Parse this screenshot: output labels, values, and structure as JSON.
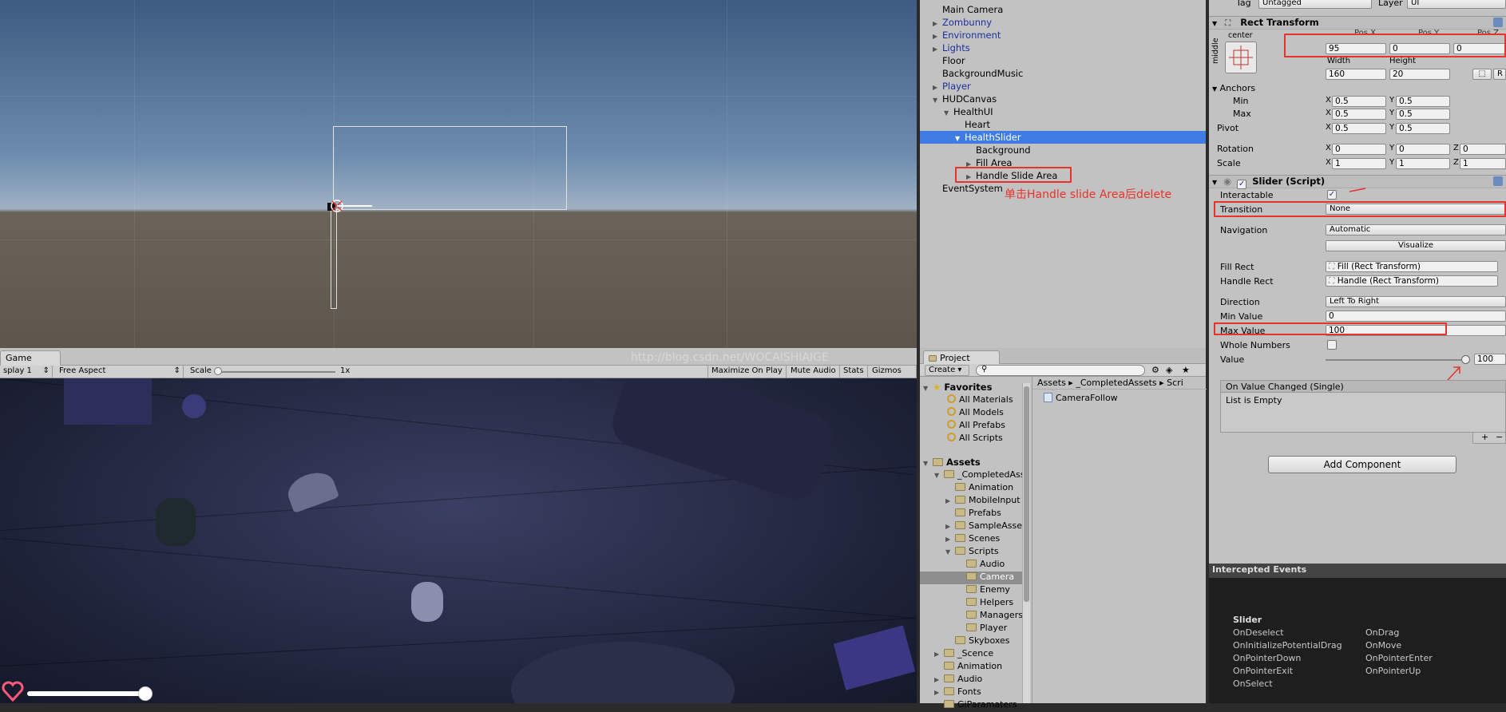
{
  "scene_view": {
    "note": ""
  },
  "game_view": {
    "tab_label": "Game",
    "display": "splay 1",
    "aspect": "Free Aspect",
    "scale_label": "Scale",
    "scale_value": "1x",
    "maximize": "Maximize On Play",
    "mute": "Mute Audio",
    "stats": "Stats",
    "gizmos": "Gizmos",
    "watermark": "http://blog.csdn.net/WOCAISHIAIGE"
  },
  "hierarchy": {
    "items": [
      {
        "label": "Main Camera",
        "depth": 0,
        "arrow": "",
        "style": ""
      },
      {
        "label": "Zombunny",
        "depth": 0,
        "arrow": "▶",
        "style": "blue"
      },
      {
        "label": "Environment",
        "depth": 0,
        "arrow": "▶",
        "style": "blue"
      },
      {
        "label": "Lights",
        "depth": 0,
        "arrow": "▶",
        "style": "blue"
      },
      {
        "label": "Floor",
        "depth": 0,
        "arrow": "",
        "style": ""
      },
      {
        "label": "BackgroundMusic",
        "depth": 0,
        "arrow": "",
        "style": ""
      },
      {
        "label": "Player",
        "depth": 0,
        "arrow": "▶",
        "style": "blue"
      },
      {
        "label": "HUDCanvas",
        "depth": 0,
        "arrow": "▼",
        "style": ""
      },
      {
        "label": "HealthUI",
        "depth": 1,
        "arrow": "▼",
        "style": ""
      },
      {
        "label": "Heart",
        "depth": 2,
        "arrow": "",
        "style": ""
      },
      {
        "label": "HealthSlider",
        "depth": 2,
        "arrow": "▼",
        "style": "sel"
      },
      {
        "label": "Background",
        "depth": 3,
        "arrow": "",
        "style": ""
      },
      {
        "label": "Fill Area",
        "depth": 3,
        "arrow": "▶",
        "style": ""
      },
      {
        "label": "Handle Slide Area",
        "depth": 3,
        "arrow": "▶",
        "style": ""
      },
      {
        "label": "EventSystem",
        "depth": 0,
        "arrow": "",
        "style": ""
      }
    ],
    "annotation": "单击Handle slide Area后delete"
  },
  "project": {
    "tab_label": "Project",
    "create_label": "Create",
    "favorites_label": "Favorites",
    "favorites": [
      "All Materials",
      "All Models",
      "All Prefabs",
      "All Scripts"
    ],
    "assets_label": "Assets",
    "tree": [
      {
        "label": "_CompletedAss",
        "depth": 1,
        "arrow": "▼"
      },
      {
        "label": "Animation",
        "depth": 2,
        "arrow": ""
      },
      {
        "label": "MobileInput",
        "depth": 2,
        "arrow": "▶"
      },
      {
        "label": "Prefabs",
        "depth": 2,
        "arrow": ""
      },
      {
        "label": "SampleAsse",
        "depth": 2,
        "arrow": "▶"
      },
      {
        "label": "Scenes",
        "depth": 2,
        "arrow": "▶"
      },
      {
        "label": "Scripts",
        "depth": 2,
        "arrow": "▼"
      },
      {
        "label": "Audio",
        "depth": 3,
        "arrow": ""
      },
      {
        "label": "Camera",
        "depth": 3,
        "arrow": ""
      },
      {
        "label": "Enemy",
        "depth": 3,
        "arrow": ""
      },
      {
        "label": "Helpers",
        "depth": 3,
        "arrow": ""
      },
      {
        "label": "Managers",
        "depth": 3,
        "arrow": ""
      },
      {
        "label": "Player",
        "depth": 3,
        "arrow": ""
      },
      {
        "label": "Skyboxes",
        "depth": 2,
        "arrow": ""
      },
      {
        "label": "_Scence",
        "depth": 1,
        "arrow": "▶"
      },
      {
        "label": "Animation",
        "depth": 1,
        "arrow": ""
      },
      {
        "label": "Audio",
        "depth": 1,
        "arrow": "▶"
      },
      {
        "label": "Fonts",
        "depth": 1,
        "arrow": "▶"
      },
      {
        "label": "GiParamaters",
        "depth": 1,
        "arrow": ""
      }
    ],
    "breadcrumb": [
      "Assets",
      "_CompletedAssets",
      "Scri"
    ],
    "file": "CameraFollow"
  },
  "inspector": {
    "tag_label": "Tag",
    "tag_value": "Untagged",
    "layer_label": "Layer",
    "layer_value": "UI",
    "rect_transform": {
      "title": "Rect Transform",
      "anchor_h": "center",
      "anchor_v": "middle",
      "posx_label": "Pos X",
      "posy_label": "Pos Y",
      "posz_label": "Pos Z",
      "posx": "95",
      "posy": "0",
      "posz": "0",
      "width_label": "Width",
      "height_label": "Height",
      "width": "160",
      "height": "20",
      "r_label": "R",
      "anchors_label": "Anchors",
      "min_label": "Min",
      "max_label": "Max",
      "min_x": "0.5",
      "min_y": "0.5",
      "max_x": "0.5",
      "max_y": "0.5",
      "pivot_label": "Pivot",
      "pivot_x": "0.5",
      "pivot_y": "0.5",
      "rotation_label": "Rotation",
      "rot_x": "0",
      "rot_y": "0",
      "rot_z": "0",
      "scale_label": "Scale",
      "scale_x": "1",
      "scale_y": "1",
      "scale_z": "1",
      "x": "X",
      "y": "Y",
      "z": "Z"
    },
    "slider": {
      "title": "Slider (Script)",
      "interactable_label": "Interactable",
      "transition_label": "Transition",
      "transition_value": "None",
      "navigation_label": "Navigation",
      "navigation_value": "Automatic",
      "visualize_label": "Visualize",
      "fill_rect_label": "Fill Rect",
      "fill_rect_value": "Fill (Rect Transform)",
      "handle_rect_label": "Handle Rect",
      "handle_rect_value": "Handle (Rect Transform)",
      "direction_label": "Direction",
      "direction_value": "Left To Right",
      "min_value_label": "Min Value",
      "min_value": "0",
      "max_value_label": "Max Value",
      "max_value": "100",
      "whole_numbers_label": "Whole Numbers",
      "value_label": "Value",
      "value": "100",
      "value_fraction": 1.0,
      "event_label": "On Value Changed (Single)",
      "event_empty": "List is Empty",
      "plus": "+",
      "minus": "−"
    },
    "add_component": "Add Component",
    "intercepted": {
      "title": "Intercepted Events",
      "component": "Slider",
      "col1": [
        "OnDeselect",
        "OnInitializePotentialDrag",
        "OnPointerDown",
        "OnPointerExit",
        "OnSelect"
      ],
      "col2": [
        "OnDrag",
        "OnMove",
        "OnPointerEnter",
        "OnPointerUp"
      ]
    }
  },
  "colors": {
    "selection": "#3e7ce4",
    "annotation": "#e8322b",
    "editor_bg": "#c2c2c2"
  }
}
